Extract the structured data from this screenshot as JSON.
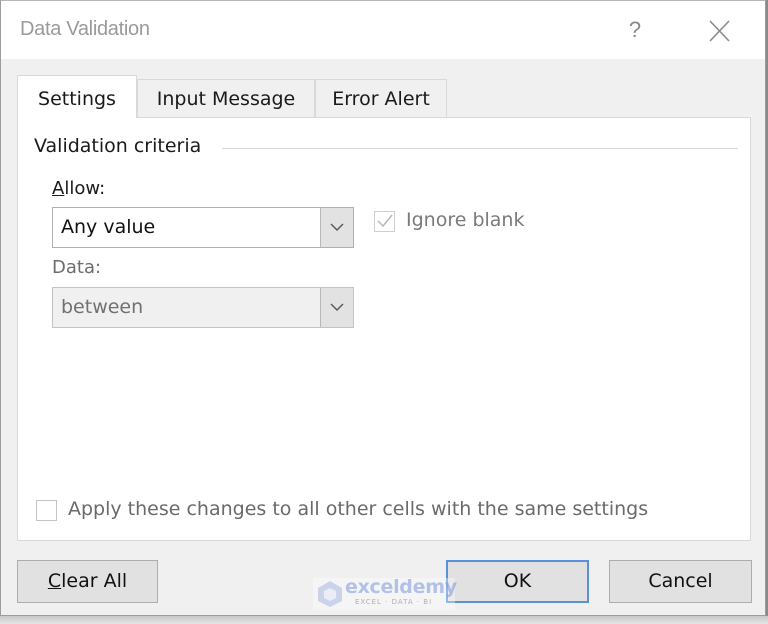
{
  "window": {
    "title": "Data Validation",
    "help_label": "?",
    "close_icon": "close-icon"
  },
  "tabs": [
    {
      "label": "Settings",
      "active": true
    },
    {
      "label": "Input Message",
      "active": false
    },
    {
      "label": "Error Alert",
      "active": false
    }
  ],
  "settings": {
    "group_title": "Validation criteria",
    "allow": {
      "label": "Allow:",
      "value": "Any value"
    },
    "ignore_blank": {
      "label": "Ignore blank",
      "checked": true,
      "disabled": true
    },
    "data": {
      "label": "Data:",
      "value": "between",
      "disabled": true
    },
    "apply_all": {
      "label": "Apply these changes to all other cells with the same settings",
      "checked": false
    }
  },
  "buttons": {
    "clear_all_accel": "C",
    "clear_all_rest": "lear All",
    "ok": "OK",
    "cancel": "Cancel"
  },
  "watermark": {
    "name": "exceldemy",
    "tagline": "EXCEL · DATA · BI"
  }
}
